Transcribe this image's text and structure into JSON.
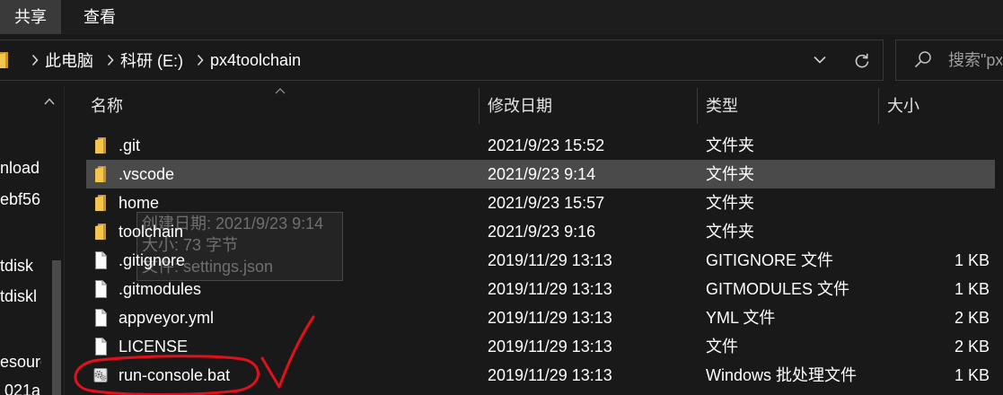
{
  "ribbon": {
    "tabs": [
      {
        "label": "共享",
        "selected": true
      },
      {
        "label": "查看",
        "selected": false
      }
    ]
  },
  "address": {
    "location_icon": "folder-icon",
    "breadcrumb": [
      "此电脑",
      "科研 (E:)",
      "px4toolchain"
    ],
    "dropdown_icon": "chevron-down-icon",
    "refresh_icon": "refresh-icon"
  },
  "search": {
    "icon": "search-icon",
    "placeholder": "搜索\"px"
  },
  "nav": {
    "items": [
      "nload",
      "ebf56",
      "tdisk",
      "tdiskl",
      "esourc",
      "021a"
    ]
  },
  "columns": {
    "name": "名称",
    "modified": "修改日期",
    "type": "类型",
    "size": "大小"
  },
  "files": [
    {
      "name": ".git",
      "modified": "2021/9/23 15:52",
      "type": "文件夹",
      "size": "",
      "icon": "folder-icon"
    },
    {
      "name": ".vscode",
      "modified": "2021/9/23 9:14",
      "type": "文件夹",
      "size": "",
      "icon": "folder-icon",
      "selected": true
    },
    {
      "name": "home",
      "modified": "2021/9/23 15:57",
      "type": "文件夹",
      "size": "",
      "icon": "folder-icon"
    },
    {
      "name": "toolchain",
      "modified": "2021/9/23 9:16",
      "type": "文件夹",
      "size": "",
      "icon": "folder-icon"
    },
    {
      "name": ".gitignore",
      "modified": "2019/11/29 13:13",
      "type": "GITIGNORE 文件",
      "size": "1 KB",
      "icon": "file-icon"
    },
    {
      "name": ".gitmodules",
      "modified": "2019/11/29 13:13",
      "type": "GITMODULES 文件",
      "size": "1 KB",
      "icon": "file-icon"
    },
    {
      "name": "appveyor.yml",
      "modified": "2019/11/29 13:13",
      "type": "YML 文件",
      "size": "2 KB",
      "icon": "file-icon"
    },
    {
      "name": "LICENSE",
      "modified": "2019/11/29 13:13",
      "type": "文件",
      "size": "2 KB",
      "icon": "file-icon"
    },
    {
      "name": "run-console.bat",
      "modified": "2019/11/29 13:13",
      "type": "Windows 批处理文件",
      "size": "1 KB",
      "icon": "batch-file-icon"
    }
  ],
  "tooltip": {
    "lines": [
      "创建日期: 2021/9/23 9:14",
      "大小: 73 字节",
      "文件: settings.json"
    ]
  },
  "colors": {
    "background": "#191919",
    "selected_row": "#4a4a4a",
    "folder": "#f3c54f",
    "annotation": "#e3101b"
  }
}
